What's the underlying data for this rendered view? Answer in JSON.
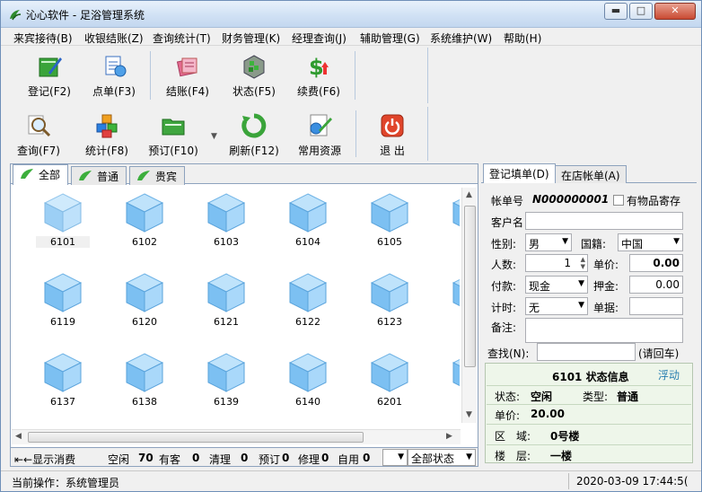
{
  "window": {
    "title": "沁心软件 - 足浴管理系统",
    "minimize": "▬",
    "maximize": "□",
    "close": "✕"
  },
  "menu": [
    "来宾接待(B)",
    "收银结账(Z)",
    "查询统计(T)",
    "财务管理(K)",
    "经理查询(J)",
    "辅助管理(G)",
    "系统维护(W)",
    "帮助(H)"
  ],
  "toolbar1": [
    {
      "label": "登记(F2)",
      "icon": "register-icon"
    },
    {
      "label": "点单(F3)",
      "icon": "order-icon"
    },
    {
      "label": "结账(F4)",
      "icon": "checkout-icon"
    },
    {
      "label": "状态(F5)",
      "icon": "status-icon"
    },
    {
      "label": "续费(F6)",
      "icon": "renew-icon"
    }
  ],
  "toolbar2": [
    {
      "label": "查询(F7)",
      "icon": "search-icon"
    },
    {
      "label": "统计(F8)",
      "icon": "stats-icon"
    },
    {
      "label": "预订(F10)",
      "icon": "reserve-icon"
    },
    {
      "label": "刷新(F12)",
      "icon": "refresh-icon"
    },
    {
      "label": "常用资源",
      "icon": "resource-icon"
    },
    {
      "label": "退  出",
      "icon": "exit-icon"
    }
  ],
  "room_tabs": [
    "全部",
    "普通",
    "贵宾"
  ],
  "rooms": [
    [
      "6101",
      "6102",
      "6103",
      "6104",
      "6105",
      "6"
    ],
    [
      "6119",
      "6120",
      "6121",
      "6122",
      "6123",
      "6"
    ],
    [
      "6137",
      "6138",
      "6139",
      "6140",
      "6201",
      "6"
    ]
  ],
  "legend": {
    "toggle": "⇤←显示消费",
    "items": [
      {
        "label": "空闲",
        "count": "70"
      },
      {
        "label": "有客",
        "count": "0"
      },
      {
        "label": "清理",
        "count": "0"
      },
      {
        "label": "预订",
        "count": "0"
      },
      {
        "label": "修理",
        "count": "0"
      },
      {
        "label": "自用",
        "count": "0"
      }
    ],
    "filter": "全部状态"
  },
  "right_tabs": [
    "登记填单(D)",
    "在店帐单(A)"
  ],
  "form": {
    "bill_no_label": "帐单号",
    "bill_no": "N000000001",
    "deposit_items_label": "有物品寄存",
    "customer_label": "客户名",
    "customer": "",
    "gender_label": "性别:",
    "gender": "男",
    "nationality_label": "国籍:",
    "nationality": "中国",
    "people_label": "人数:",
    "people": "1",
    "price_label": "单价:",
    "price": "0.00",
    "payment_label": "付款:",
    "payment": "现金",
    "deposit_label": "押金:",
    "deposit": "0.00",
    "timing_label": "计时:",
    "timing": "无",
    "voucher_label": "单据:",
    "voucher": "",
    "remark_label": "备注:",
    "remark": ""
  },
  "search": {
    "label": "查找(N):",
    "value": "",
    "hint": "(请回车)"
  },
  "info": {
    "title": "6101 状态信息",
    "float": "浮动",
    "state_label": "状态:",
    "state": "空闲",
    "type_label": "类型:",
    "type": "普通",
    "price_label": "单价:",
    "price": "20.00",
    "area_label": "区　域:",
    "area": "0号楼",
    "floor_label": "楼　层:",
    "floor": "一楼"
  },
  "statusbar": {
    "operation": "当前操作：系统管理员",
    "datetime": "2020-03-09 17:44:5("
  }
}
